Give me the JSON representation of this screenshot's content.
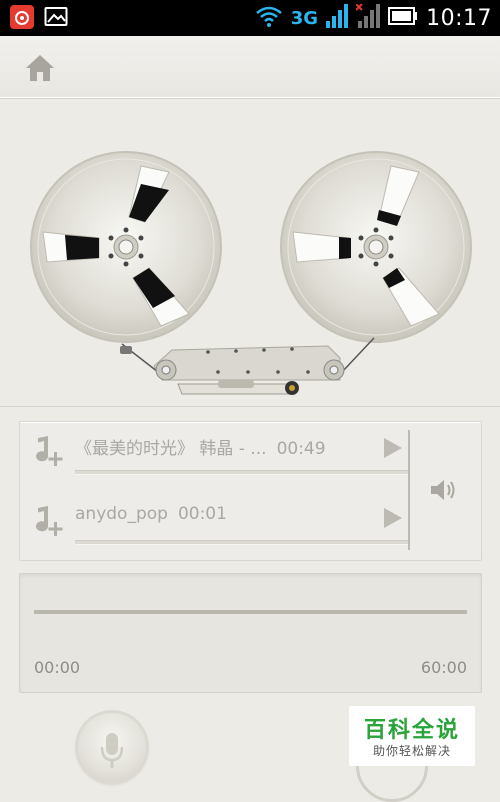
{
  "status_bar": {
    "network_type": "3G",
    "time": "10:17",
    "icons": [
      "netease-music-icon",
      "image-notification-icon",
      "wifi-icon",
      "signal-icon",
      "no-signal-icon",
      "battery-icon"
    ]
  },
  "toolbar": {
    "home_icon": "home-icon"
  },
  "playlist": {
    "tracks": [
      {
        "title": "《最美的时光》 韩晶 - ...",
        "duration": "00:49"
      },
      {
        "title": "anydo_pop",
        "duration": "00:01"
      }
    ]
  },
  "progress": {
    "elapsed": "00:00",
    "total": "60:00",
    "position": 0
  },
  "watermark": {
    "title": "百科全说",
    "subtitle": "助你轻松解决"
  },
  "colors": {
    "background": "#ecebe6",
    "accent": "#2bb5ee",
    "watermark": "#2aa33b"
  }
}
